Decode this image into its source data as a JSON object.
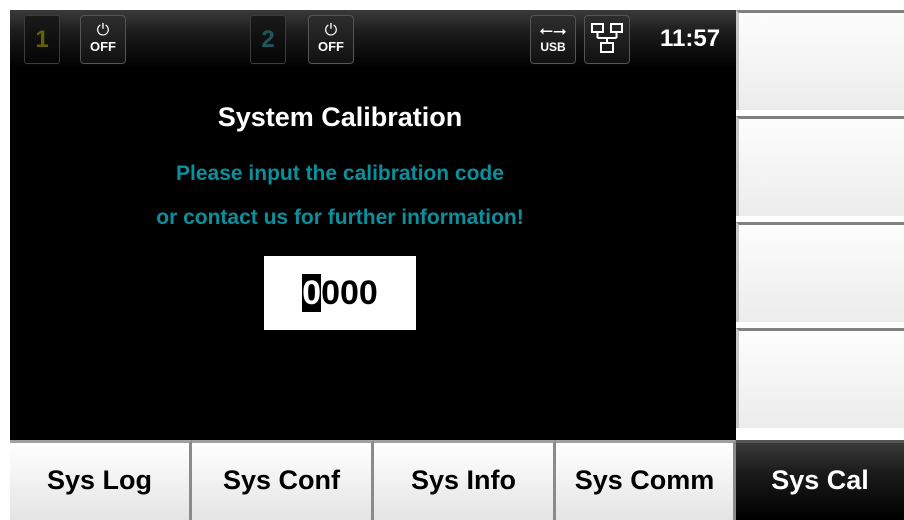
{
  "status_bar": {
    "channel1": {
      "number": "1",
      "power_label": "OFF",
      "power_icon": "power-icon"
    },
    "channel2": {
      "number": "2",
      "power_label": "OFF",
      "power_icon": "power-icon"
    },
    "usb": {
      "label": "USB",
      "icon": "usb-icon"
    },
    "network": {
      "icon": "network-icon"
    },
    "time": "11:57"
  },
  "main": {
    "title": "System Calibration",
    "message_line1": "Please input the calibration code",
    "message_line2": "or contact us for further information!",
    "code_input": {
      "first_digit": "0",
      "remaining_digits": "000"
    },
    "accent_color": "#0a8f9c"
  },
  "right_softkeys": [
    "",
    "",
    "",
    ""
  ],
  "bottom_menu": {
    "items": [
      {
        "label": "Sys Log"
      },
      {
        "label": "Sys Conf"
      },
      {
        "label": "Sys Info"
      },
      {
        "label": "Sys Comm"
      },
      {
        "label": "Sys Cal"
      }
    ],
    "active": "Sys Cal"
  }
}
